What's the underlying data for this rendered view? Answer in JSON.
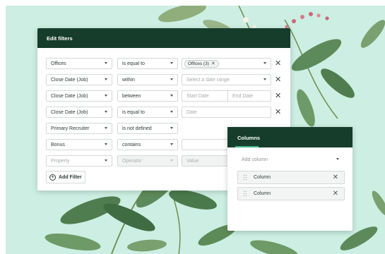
{
  "filters_panel": {
    "title": "Edit filters",
    "rows": [
      {
        "field": "Offices",
        "operator": "is equal to",
        "chip": "Offices (3)",
        "chip_remove": "✕",
        "remove": "✕"
      },
      {
        "field": "Close Date (Job)",
        "operator": "within",
        "value_placeholder": "Select a date range",
        "remove": "✕"
      },
      {
        "field": "Close Date (Job)",
        "operator": "between",
        "start_placeholder": "Start Date",
        "end_placeholder": "End Date",
        "remove": "✕"
      },
      {
        "field": "Close Date (Job)",
        "operator": "is equal to",
        "value_placeholder": "Date",
        "remove": "✕"
      },
      {
        "field": "Primary Recruiter",
        "operator": "is not defined"
      },
      {
        "field": "Bonus",
        "operator": "contains"
      },
      {
        "field_placeholder": "Property",
        "operator_placeholder": "Operator",
        "value_placeholder": "Value"
      }
    ],
    "add_filter": {
      "icon": "plus-circle-icon",
      "label": "Add Filter"
    }
  },
  "columns_panel": {
    "tab_label": "Columns",
    "add_column_placeholder": "Add column",
    "items": [
      {
        "label": "Column",
        "remove": "✕"
      },
      {
        "label": "Column",
        "remove": "✕"
      }
    ]
  },
  "colors": {
    "header_dark_green": "#163c2c",
    "tab_accent": "#3fb68a",
    "background_mint": "#cdeee2"
  }
}
